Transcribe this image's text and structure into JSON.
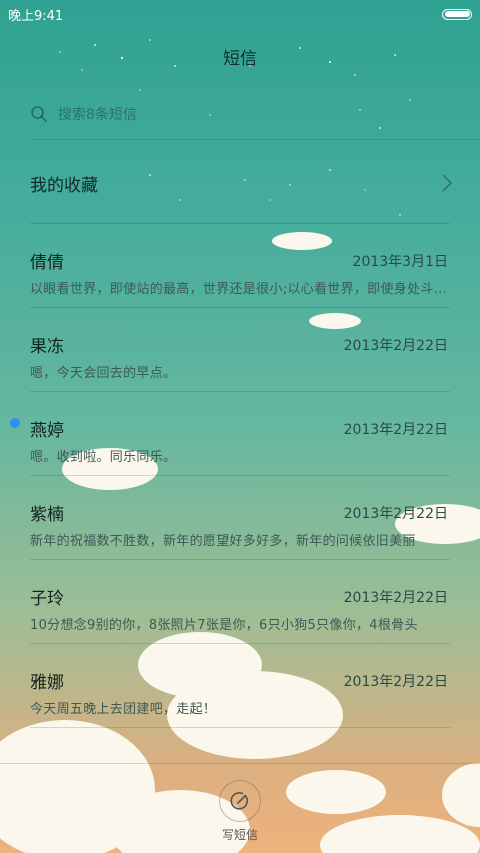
{
  "status_bar": {
    "time": "晚上9:41"
  },
  "header": {
    "title": "短信"
  },
  "search": {
    "placeholder": "搜索8条短信"
  },
  "favorites": {
    "label": "我的收藏"
  },
  "threads": [
    {
      "name": "倩倩",
      "date": "2013年3月1日",
      "preview": "以眼看世界，即使站的最高，世界还是很小;以心看世界，即使身处斗室，世界也是很大",
      "unread": false
    },
    {
      "name": "果冻",
      "date": "2013年2月22日",
      "preview": "嗯，今天会回去的早点。",
      "unread": false
    },
    {
      "name": "燕婷",
      "date": "2013年2月22日",
      "preview": "嗯。收到啦。同乐同乐。",
      "unread": true
    },
    {
      "name": "紫楠",
      "date": "2013年2月22日",
      "preview": "新年的祝福数不胜数，新年的愿望好多好多，新年的问候依旧美丽",
      "unread": false
    },
    {
      "name": "子玲",
      "date": "2013年2月22日",
      "preview": "10分想念9别的你，8张照片7张是你，6只小狗5只像你，4根骨头",
      "unread": false
    },
    {
      "name": "雅娜",
      "date": "2013年2月22日",
      "preview": "今天周五晚上去团建吧，走起！",
      "unread": false
    }
  ],
  "compose": {
    "label": "写短信",
    "icon": "compose-icon"
  },
  "colors": {
    "unread_dot": "#2f8ff0",
    "bg_top": "#2fa192",
    "bg_bottom": "#eeb27c"
  }
}
